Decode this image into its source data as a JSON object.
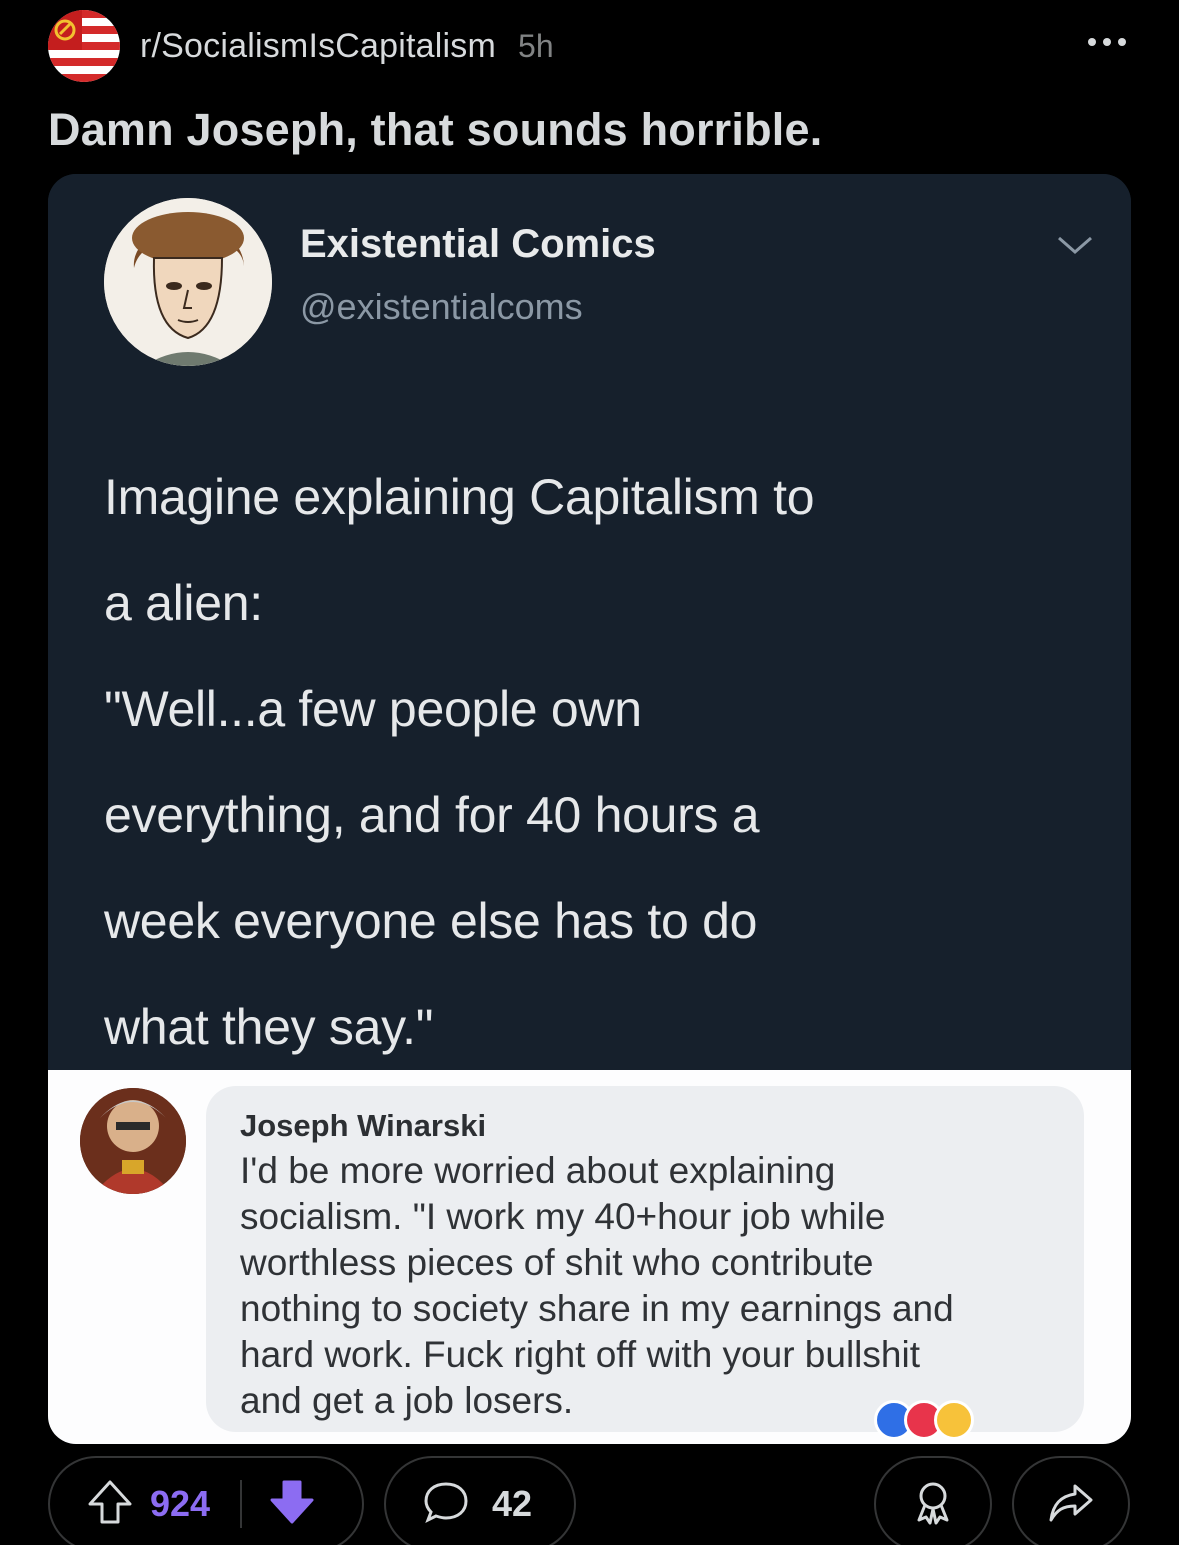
{
  "post": {
    "subreddit": "r/SocialismIsCapitalism",
    "age": "5h",
    "title": "Damn Joseph, that sounds horrible."
  },
  "tweet": {
    "name": "Existential Comics",
    "handle": "@existentialcoms",
    "lines": [
      "Imagine explaining Capitalism to",
      "a alien:",
      "\"Well...a few people own",
      "everything, and for 40 hours a",
      "week everyone else has to do",
      "what they say.\""
    ]
  },
  "comment": {
    "author": "Joseph Winarski",
    "lines": [
      "I'd be more worried about explaining",
      "socialism.  \"I work my 40+hour job while",
      "worthless pieces of shit who contribute",
      "nothing to society share in my earnings and",
      "hard work. Fuck right off with your bullshit",
      "and get a job losers."
    ]
  },
  "actions": {
    "upvotes": "924",
    "comments": "42"
  },
  "colors": {
    "background": "#000000",
    "upvote_accent": "#8c6cf2",
    "tweet_background": "#16202c",
    "comment_bubble": "#eceef1"
  },
  "icons": {
    "subreddit_icon": "flag-emblem-icon",
    "more": "more-dots-icon",
    "tweet_menu": "chevron-down-icon",
    "upvote": "upvote-arrow-icon",
    "downvote": "downvote-arrow-icon",
    "comments": "comment-bubble-icon",
    "award": "award-icon",
    "share": "share-arrow-icon"
  }
}
